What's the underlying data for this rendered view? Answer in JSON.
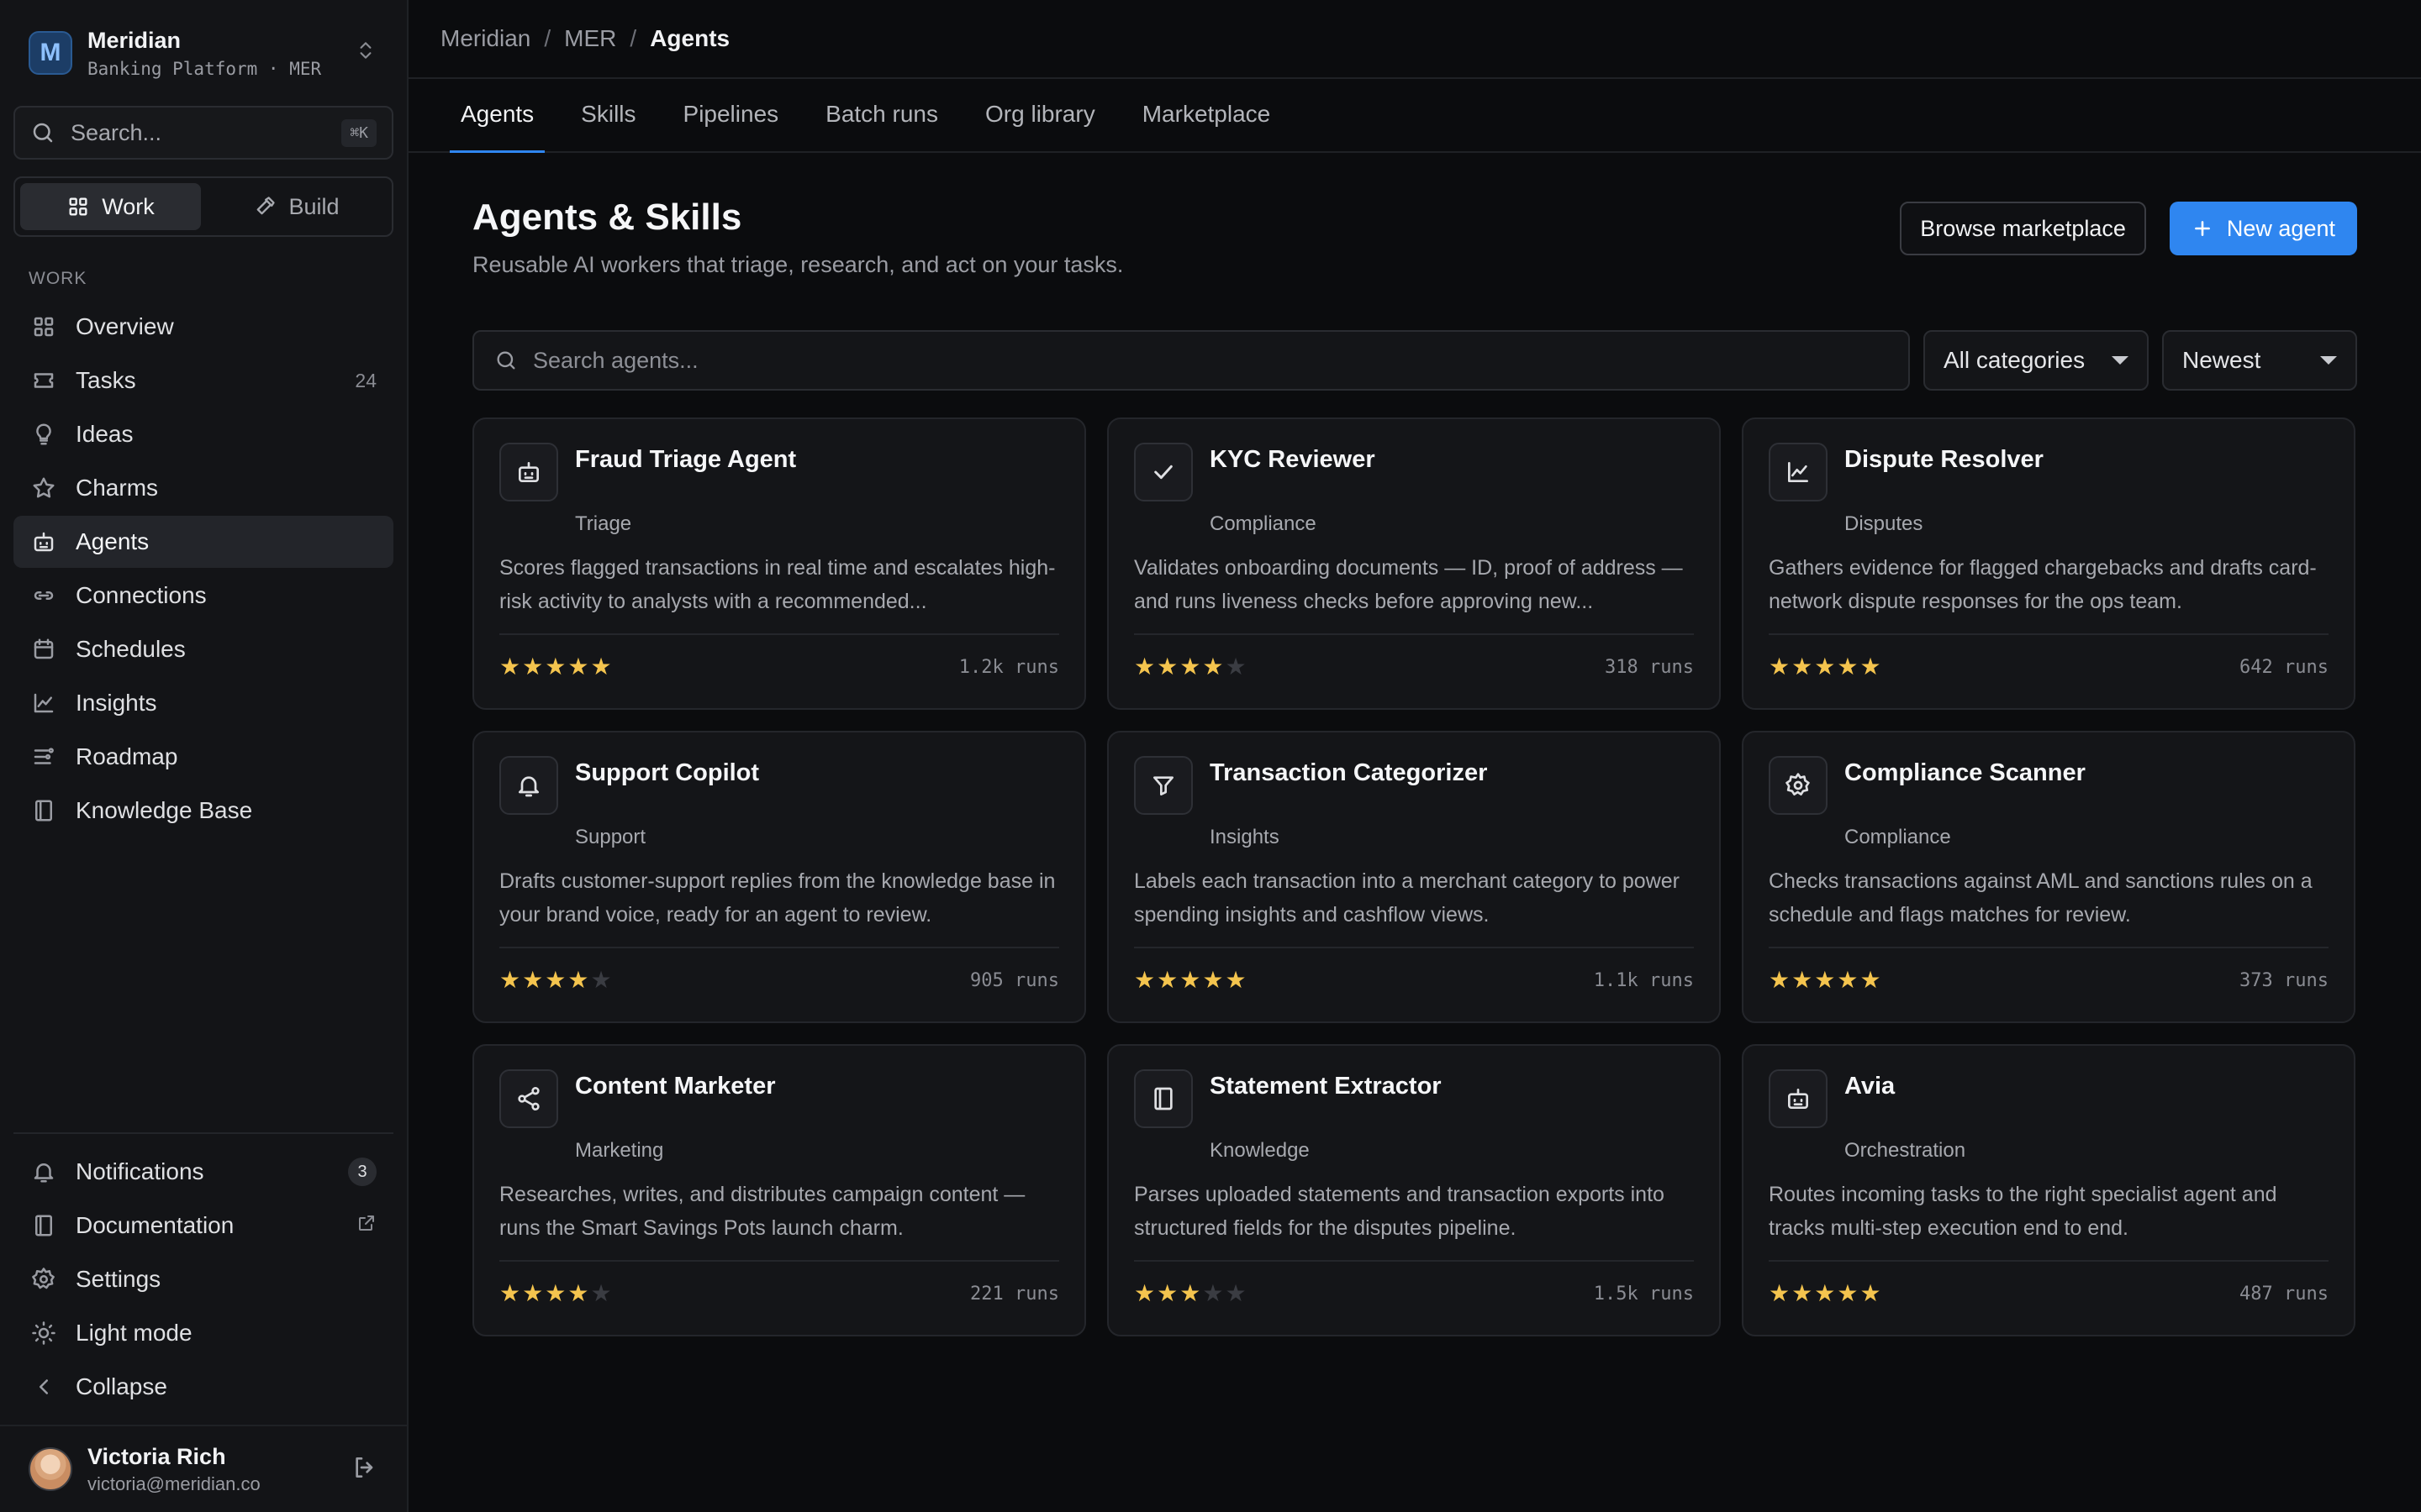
{
  "colors": {
    "accent": "#2f86f0",
    "star": "#f4c44e",
    "background": "#0b0c0e",
    "sidebar": "#131417"
  },
  "workspace": {
    "initial": "M",
    "name": "Meridian",
    "subtitle": "Banking Platform · MER"
  },
  "sidebar": {
    "search_placeholder": "Search...",
    "search_shortcut": "⌘K",
    "mode": {
      "work": "Work",
      "build": "Build",
      "active": "work"
    },
    "section_label": "WORK",
    "items": [
      {
        "label": "Overview",
        "icon": "grid-icon"
      },
      {
        "label": "Tasks",
        "icon": "ticket-icon",
        "count": "24"
      },
      {
        "label": "Ideas",
        "icon": "lightbulb-icon"
      },
      {
        "label": "Charms",
        "icon": "star-icon"
      },
      {
        "label": "Agents",
        "icon": "bot-icon",
        "active": true
      },
      {
        "label": "Connections",
        "icon": "link-icon"
      },
      {
        "label": "Schedules",
        "icon": "calendar-icon"
      },
      {
        "label": "Insights",
        "icon": "chart-icon"
      },
      {
        "label": "Roadmap",
        "icon": "roadmap-icon"
      },
      {
        "label": "Knowledge Base",
        "icon": "book-icon"
      }
    ],
    "bottom": [
      {
        "label": "Notifications",
        "icon": "bell-icon",
        "badge": "3"
      },
      {
        "label": "Documentation",
        "icon": "book-icon",
        "external": true
      },
      {
        "label": "Settings",
        "icon": "gear-icon"
      },
      {
        "label": "Light mode",
        "icon": "sun-icon"
      },
      {
        "label": "Collapse",
        "icon": "chevron-left-icon"
      }
    ],
    "user": {
      "name": "Victoria Rich",
      "email": "victoria@meridian.co"
    }
  },
  "breadcrumb": [
    "Meridian",
    "MER",
    "Agents"
  ],
  "tabs": [
    "Agents",
    "Skills",
    "Pipelines",
    "Batch runs",
    "Org library",
    "Marketplace"
  ],
  "active_tab": "Agents",
  "page": {
    "title": "Agents & Skills",
    "subtitle": "Reusable AI workers that triage, research, and act on your tasks.",
    "browse_label": "Browse marketplace",
    "new_label": "New agent",
    "search_placeholder": "Search agents...",
    "category_select": "All categories",
    "sort_select": "Newest"
  },
  "agents": [
    {
      "name": "Fraud Triage Agent",
      "category": "Triage",
      "icon": "bot-icon",
      "description": "Scores flagged transactions in real time and escalates high-risk activity to analysts with a recommended...",
      "rating": 5,
      "runs": "1.2k runs"
    },
    {
      "name": "KYC Reviewer",
      "category": "Compliance",
      "icon": "check-icon",
      "description": "Validates onboarding documents — ID, proof of address — and runs liveness checks before approving new...",
      "rating": 4,
      "runs": "318 runs"
    },
    {
      "name": "Dispute Resolver",
      "category": "Disputes",
      "icon": "chart-icon",
      "description": "Gathers evidence for flagged chargebacks and drafts card-network dispute responses for the ops team.",
      "rating": 5,
      "runs": "642 runs"
    },
    {
      "name": "Support Copilot",
      "category": "Support",
      "icon": "bell-icon",
      "description": "Drafts customer-support replies from the knowledge base in your brand voice, ready for an agent to review.",
      "rating": 4,
      "runs": "905 runs"
    },
    {
      "name": "Transaction Categorizer",
      "category": "Insights",
      "icon": "filter-icon",
      "description": "Labels each transaction into a merchant category to power spending insights and cashflow views.",
      "rating": 5,
      "runs": "1.1k runs"
    },
    {
      "name": "Compliance Scanner",
      "category": "Compliance",
      "icon": "gear-icon",
      "description": "Checks transactions against AML and sanctions rules on a schedule and flags matches for review.",
      "rating": 5,
      "runs": "373 runs"
    },
    {
      "name": "Content Marketer",
      "category": "Marketing",
      "icon": "share-icon",
      "description": "Researches, writes, and distributes campaign content — runs the Smart Savings Pots launch charm.",
      "rating": 4,
      "runs": "221 runs"
    },
    {
      "name": "Statement Extractor",
      "category": "Knowledge",
      "icon": "book-icon",
      "description": "Parses uploaded statements and transaction exports into structured fields for the disputes pipeline.",
      "rating": 3,
      "runs": "1.5k runs"
    },
    {
      "name": "Avia",
      "category": "Orchestration",
      "icon": "bot-icon",
      "description": "Routes incoming tasks to the right specialist agent and tracks multi-step execution end to end.",
      "rating": 5,
      "runs": "487 runs"
    }
  ]
}
